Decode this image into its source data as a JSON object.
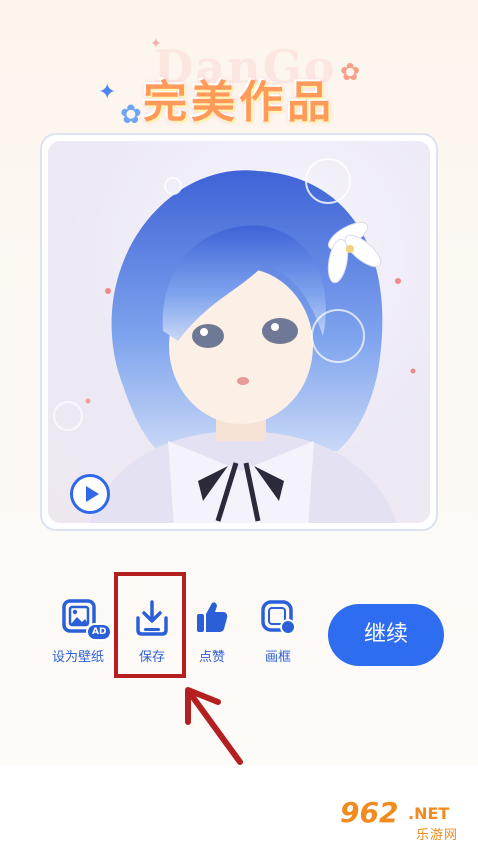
{
  "header": {
    "title": "完美作品",
    "bg_logo": "DanGo"
  },
  "artwork": {
    "type": "anime-portrait",
    "play_icon": "play-circle-icon"
  },
  "actions": [
    {
      "label": "设为壁纸",
      "icon": "wallpaper-icon",
      "badge": "AD"
    },
    {
      "label": "保存",
      "icon": "download-icon"
    },
    {
      "label": "点赞",
      "icon": "thumbs-up-icon"
    },
    {
      "label": "画框",
      "icon": "frame-icon"
    }
  ],
  "continue_button": {
    "label": "继续"
  },
  "watermark": {
    "number": "962",
    "suffix": ".NET",
    "text": "乐游网"
  },
  "colors": {
    "accent": "#2f6df0",
    "highlight": "#b41f1f",
    "title": "#ff9a5a"
  }
}
